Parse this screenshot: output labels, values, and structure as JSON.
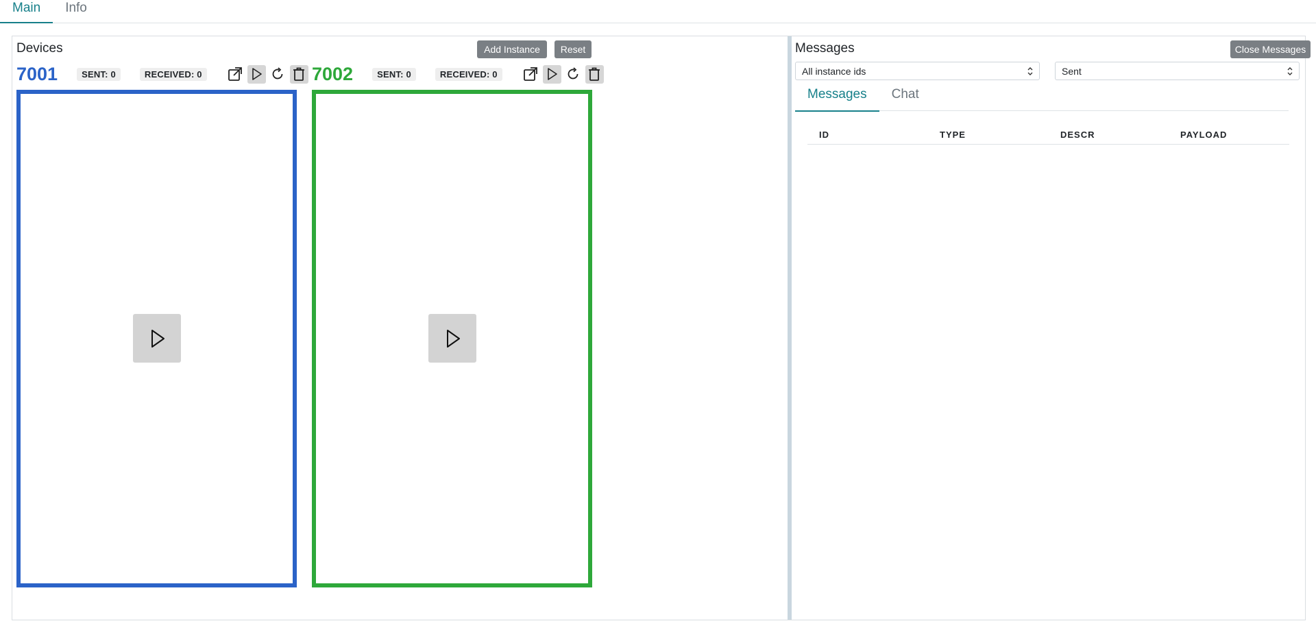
{
  "top_tabs": [
    {
      "label": "Main",
      "active": true
    },
    {
      "label": "Info",
      "active": false
    }
  ],
  "devices": {
    "title": "Devices",
    "add_instance_label": "Add Instance",
    "reset_label": "Reset",
    "instances": [
      {
        "id": "7001",
        "color": "#2b63c8",
        "sent": "SENT: 0",
        "received": "RECEIVED: 0"
      },
      {
        "id": "7002",
        "color": "#2ea83a",
        "sent": "SENT: 0",
        "received": "RECEIVED: 0"
      }
    ]
  },
  "messages": {
    "title": "Messages",
    "close_label": "Close Messages",
    "instance_filter": "All instance ids",
    "direction_filter": "Sent",
    "tabs": [
      {
        "label": "Messages",
        "active": true
      },
      {
        "label": "Chat",
        "active": false
      }
    ],
    "columns": [
      "ID",
      "TYPE",
      "DESCR",
      "PAYLOAD"
    ]
  },
  "colors": {
    "accent": "#17808a",
    "device_blue": "#2b63c8",
    "device_green": "#2ea83a",
    "button_gray": "#7a7f84"
  },
  "icons": [
    "external-link-icon",
    "play-icon",
    "refresh-icon",
    "trash-icon"
  ]
}
